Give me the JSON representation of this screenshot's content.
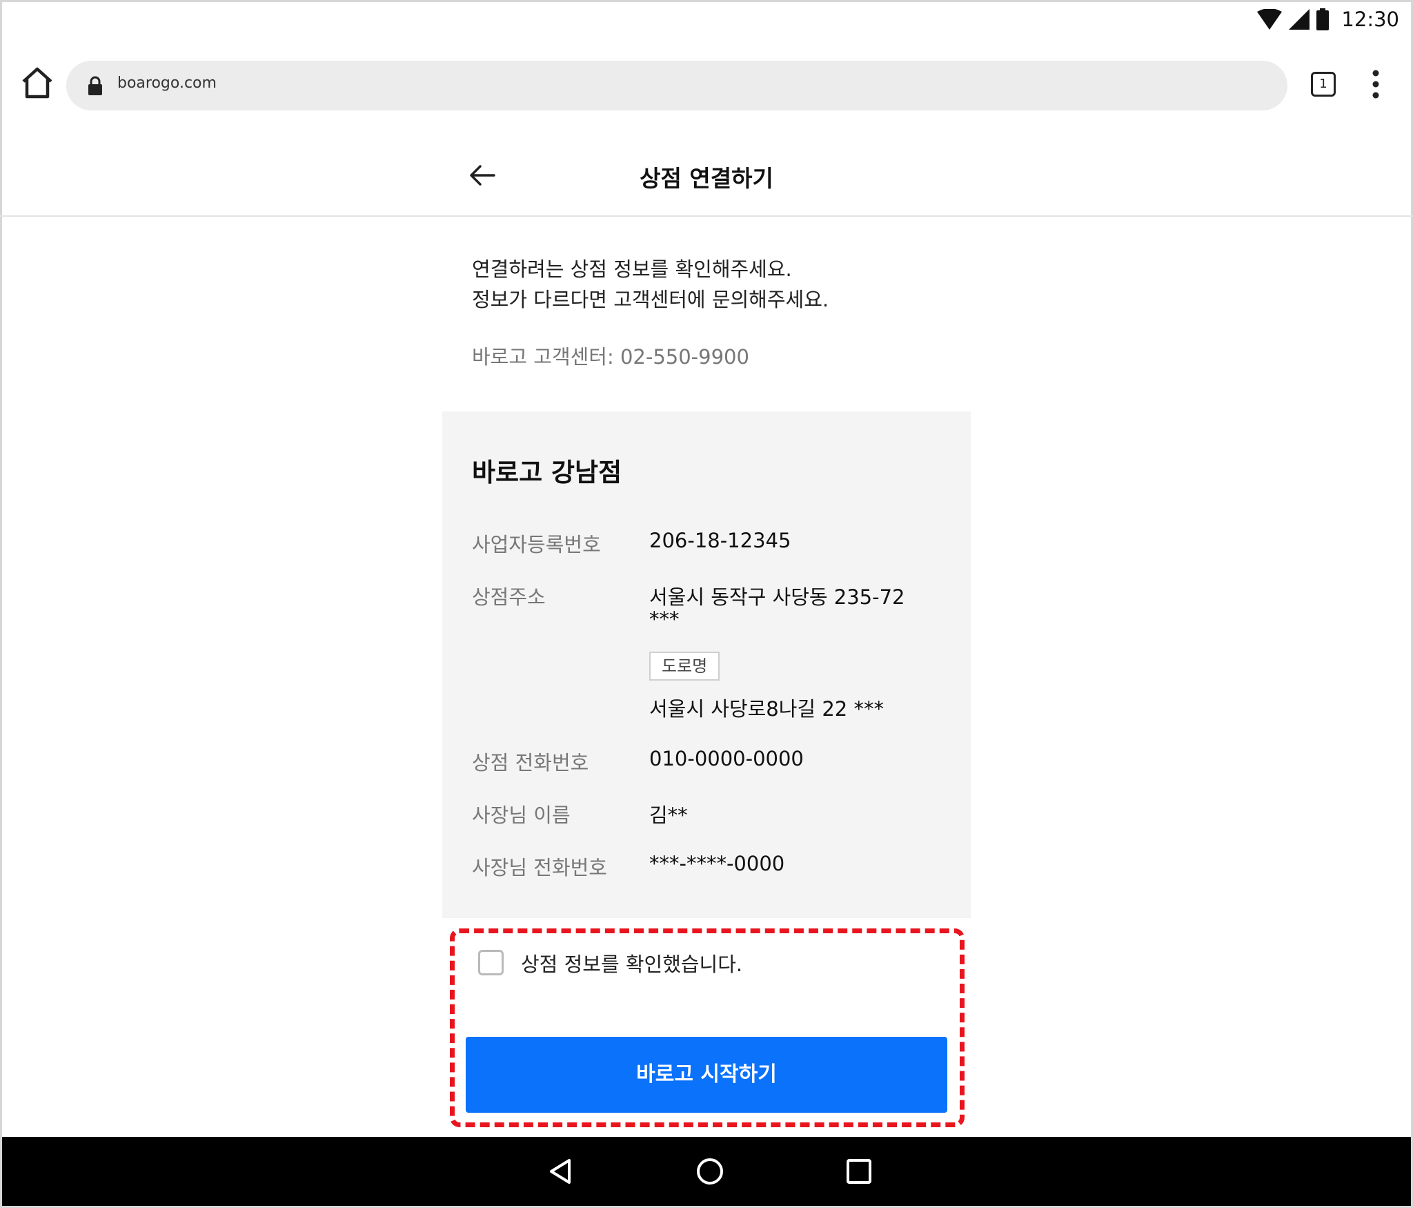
{
  "status_bar": {
    "time": "12:30",
    "icons": [
      "wifi-icon",
      "signal-icon",
      "battery-icon"
    ]
  },
  "browser": {
    "url": "boarogo.com",
    "tab_count": "1",
    "icons": [
      "home-icon",
      "lock-icon",
      "tabs-icon",
      "more-vert-icon"
    ]
  },
  "header": {
    "title": "상점 연결하기",
    "back_icon": "arrow-left-icon"
  },
  "intro": {
    "line1": "연결하려는 상점 정보를 확인해주세요.",
    "line2": "정보가 다르다면 고객센터에 문의해주세요.",
    "customer_center": "바로고 고객센터: 02-550-9900"
  },
  "store": {
    "name": "바로고 강남점",
    "rows": [
      {
        "label": "사업자등록번호",
        "value": "206-18-12345"
      },
      {
        "label": "상점주소",
        "value": "서울시 동작구 사당동 235-72",
        "value2": "***"
      },
      {
        "label": "",
        "badge": "도로명",
        "value": "서울시 사당로8나길 22 ***"
      },
      {
        "label": "상점 전화번호",
        "value": "010-0000-0000"
      },
      {
        "label": "사장님 이름",
        "value": "김**"
      },
      {
        "label": "사장님 전화번호",
        "value": "***-****-0000"
      }
    ]
  },
  "confirm": {
    "checkbox_label": "상점 정보를 확인했습니다.",
    "checked": false,
    "start_button": "바로고 시작하기"
  },
  "colors": {
    "primary": "#0a72fb",
    "highlight_border": "#e8141e",
    "card_bg": "#f4f4f4",
    "muted_text": "#777777"
  },
  "nav_bar": {
    "icons": [
      "nav-back-icon",
      "nav-home-icon",
      "nav-recents-icon"
    ]
  }
}
